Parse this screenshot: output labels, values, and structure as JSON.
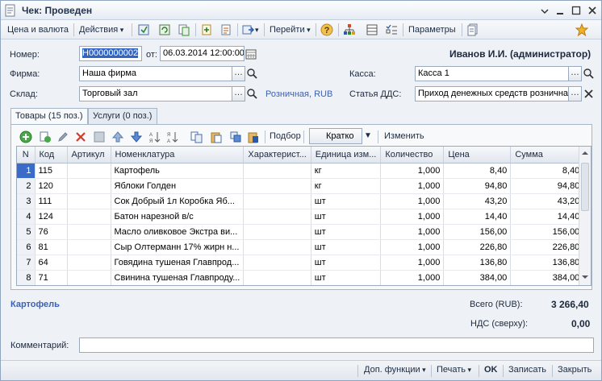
{
  "window": {
    "title": "Чек: Проведен"
  },
  "toolbar": {
    "prices_currency": "Цена и валюта",
    "actions": "Действия",
    "goto": "Перейти",
    "parameters": "Параметры"
  },
  "header": {
    "number_label": "Номер:",
    "number_value": "Н0000000002",
    "from_label": "от:",
    "date_value": "06.03.2014 12:00:00",
    "user": "Иванов И.И. (администратор)",
    "firm_label": "Фирма:",
    "firm_value": "Наша фирма",
    "cash_label": "Касса:",
    "cash_value": "Касса 1",
    "warehouse_label": "Склад:",
    "warehouse_value": "Торговый зал",
    "price_type_link": "Розничная, RUB",
    "dds_label": "Статья ДДС:",
    "dds_value": "Приход денежных средств розничная"
  },
  "tabs": [
    {
      "label": "Товары (15 поз.)",
      "active": true
    },
    {
      "label": "Услуги (0 поз.)",
      "active": false
    }
  ],
  "table_toolbar": {
    "selection": "Подбор",
    "mode": "Кратко",
    "change": "Изменить"
  },
  "table": {
    "columns": [
      "N",
      "Код",
      "Артикул",
      "Номенклатура",
      "Характерист...",
      "Единица изм...",
      "Количество",
      "Цена",
      "Сумма"
    ],
    "rows": [
      {
        "n": "1",
        "code": "115",
        "article": "",
        "name": "Картофель",
        "char": "",
        "unit": "кг",
        "qty": "1,000",
        "price": "8,40",
        "sum": "8,40"
      },
      {
        "n": "2",
        "code": "120",
        "article": "",
        "name": "Яблоки Голден",
        "char": "",
        "unit": "кг",
        "qty": "1,000",
        "price": "94,80",
        "sum": "94,80"
      },
      {
        "n": "3",
        "code": "111",
        "article": "",
        "name": "Сок Добрый 1л Коробка Яб...",
        "char": "",
        "unit": "шт",
        "qty": "1,000",
        "price": "43,20",
        "sum": "43,20"
      },
      {
        "n": "4",
        "code": "124",
        "article": "",
        "name": "Батон нарезной в/с",
        "char": "",
        "unit": "шт",
        "qty": "1,000",
        "price": "14,40",
        "sum": "14,40"
      },
      {
        "n": "5",
        "code": "76",
        "article": "",
        "name": "Масло оливковое Экстра ви...",
        "char": "",
        "unit": "шт",
        "qty": "1,000",
        "price": "156,00",
        "sum": "156,00"
      },
      {
        "n": "6",
        "code": "81",
        "article": "",
        "name": "Сыр Олтерманн 17% жирн н...",
        "char": "",
        "unit": "шт",
        "qty": "1,000",
        "price": "226,80",
        "sum": "226,80"
      },
      {
        "n": "7",
        "code": "64",
        "article": "",
        "name": "Говядина тушеная Главпрод...",
        "char": "",
        "unit": "шт",
        "qty": "1,000",
        "price": "136,80",
        "sum": "136,80"
      },
      {
        "n": "8",
        "code": "71",
        "article": "",
        "name": "Свинина тушеная Главпроду...",
        "char": "",
        "unit": "шт",
        "qty": "1,000",
        "price": "384,00",
        "sum": "384,00"
      }
    ]
  },
  "summary": {
    "current_item": "Картофель",
    "total_label": "Всего (RUB):",
    "total_value": "3 266,40",
    "vat_label": "НДС (сверху):",
    "vat_value": "0,00",
    "comment_label": "Комментарий:",
    "comment_value": ""
  },
  "footer": {
    "extra": "Доп. функции",
    "print": "Печать",
    "ok": "OK",
    "save": "Записать",
    "close": "Закрыть"
  },
  "colors": {
    "accent": "#3b6bc8",
    "link": "#3b62b2"
  }
}
